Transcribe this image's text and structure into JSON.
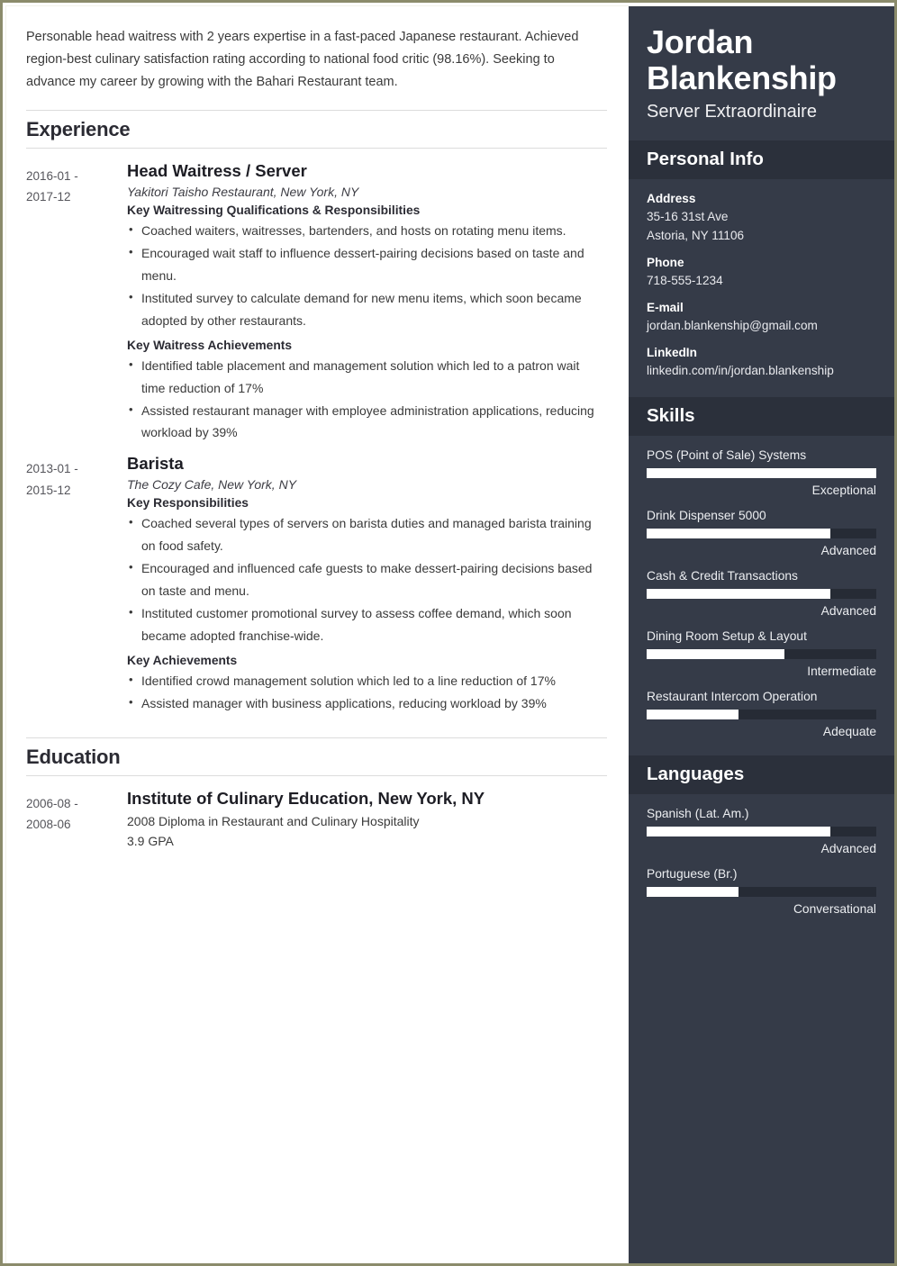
{
  "theme": {
    "sidebar_bg": "#353b48",
    "sidebar_header_bg": "#2b303b",
    "meter_track": "#262b35",
    "meter_fill": "#ffffff",
    "page_border": "#8b8b6b",
    "body_text": "#3a3a3a"
  },
  "main": {
    "summary": "Personable head waitress with 2 years expertise in a fast-paced Japanese restaurant. Achieved region-best culinary satisfaction rating according to national food critic (98.16%). Seeking to advance my career by growing with the Bahari Restaurant team.",
    "experience_heading": "Experience",
    "education_heading": "Education",
    "experience": [
      {
        "dates_from": "2016-01 -",
        "dates_to": "2017-12",
        "title": "Head Waitress / Server",
        "company": "Yakitori Taisho Restaurant, New York, NY",
        "group1_heading": "Key Waitressing Qualifications & Responsibilities",
        "group1_bullets": [
          "Coached waiters, waitresses, bartenders, and hosts on rotating menu items.",
          "Encouraged wait staff to influence dessert-pairing decisions based on taste and menu.",
          "Instituted survey to calculate demand for new menu items, which soon became adopted by other restaurants."
        ],
        "group2_heading": "Key Waitress Achievements",
        "group2_bullets": [
          "Identified table placement and management solution which led to a patron wait time reduction of 17%",
          "Assisted restaurant manager with employee administration applications, reducing workload by 39%"
        ]
      },
      {
        "dates_from": "2013-01 -",
        "dates_to": "2015-12",
        "title": "Barista",
        "company": "The Cozy Cafe, New York, NY",
        "group1_heading": "Key Responsibilities",
        "group1_bullets": [
          "Coached several types of servers on barista duties and managed barista training on food safety.",
          "Encouraged and influenced cafe guests to make dessert-pairing decisions based on taste and menu.",
          "Instituted customer promotional survey to assess coffee demand, which soon became adopted franchise-wide."
        ],
        "group2_heading": "Key Achievements",
        "group2_bullets": [
          "Identified crowd management solution which led to a line reduction of 17%",
          "Assisted manager with business applications, reducing workload by 39%"
        ]
      }
    ],
    "education": [
      {
        "dates_from": "2006-08 -",
        "dates_to": "2008-06",
        "title": "Institute of Culinary Education, New York, NY",
        "line1": "2008 Diploma in Restaurant and Culinary Hospitality",
        "line2": "3.9 GPA"
      }
    ]
  },
  "sidebar": {
    "name": "Jordan Blankenship",
    "role": "Server Extraordinaire",
    "personal_info_heading": "Personal Info",
    "personal_info": [
      {
        "label": "Address",
        "value": "35-16 31st Ave\nAstoria, NY 11106",
        "line1": "35-16 31st Ave",
        "line2": "Astoria, NY 11106"
      },
      {
        "label": "Phone",
        "line1": "718-555-1234",
        "line2": ""
      },
      {
        "label": "E-mail",
        "line1": "jordan.blankenship@gmail.com",
        "line2": ""
      },
      {
        "label": "LinkedIn",
        "line1": "linkedin.com/in/jordan.blankenship",
        "line2": ""
      }
    ],
    "skills_heading": "Skills",
    "skills": [
      {
        "name": "POS (Point of Sale) Systems",
        "level": "Exceptional",
        "percent": 100
      },
      {
        "name": "Drink Dispenser 5000",
        "level": "Advanced",
        "percent": 80
      },
      {
        "name": "Cash & Credit Transactions",
        "level": "Advanced",
        "percent": 80
      },
      {
        "name": "Dining Room Setup & Layout",
        "level": "Intermediate",
        "percent": 60
      },
      {
        "name": "Restaurant Intercom Operation",
        "level": "Adequate",
        "percent": 40
      }
    ],
    "languages_heading": "Languages",
    "languages": [
      {
        "name": "Spanish (Lat. Am.)",
        "level": "Advanced",
        "percent": 80
      },
      {
        "name": "Portuguese (Br.)",
        "level": "Conversational",
        "percent": 40
      }
    ]
  }
}
